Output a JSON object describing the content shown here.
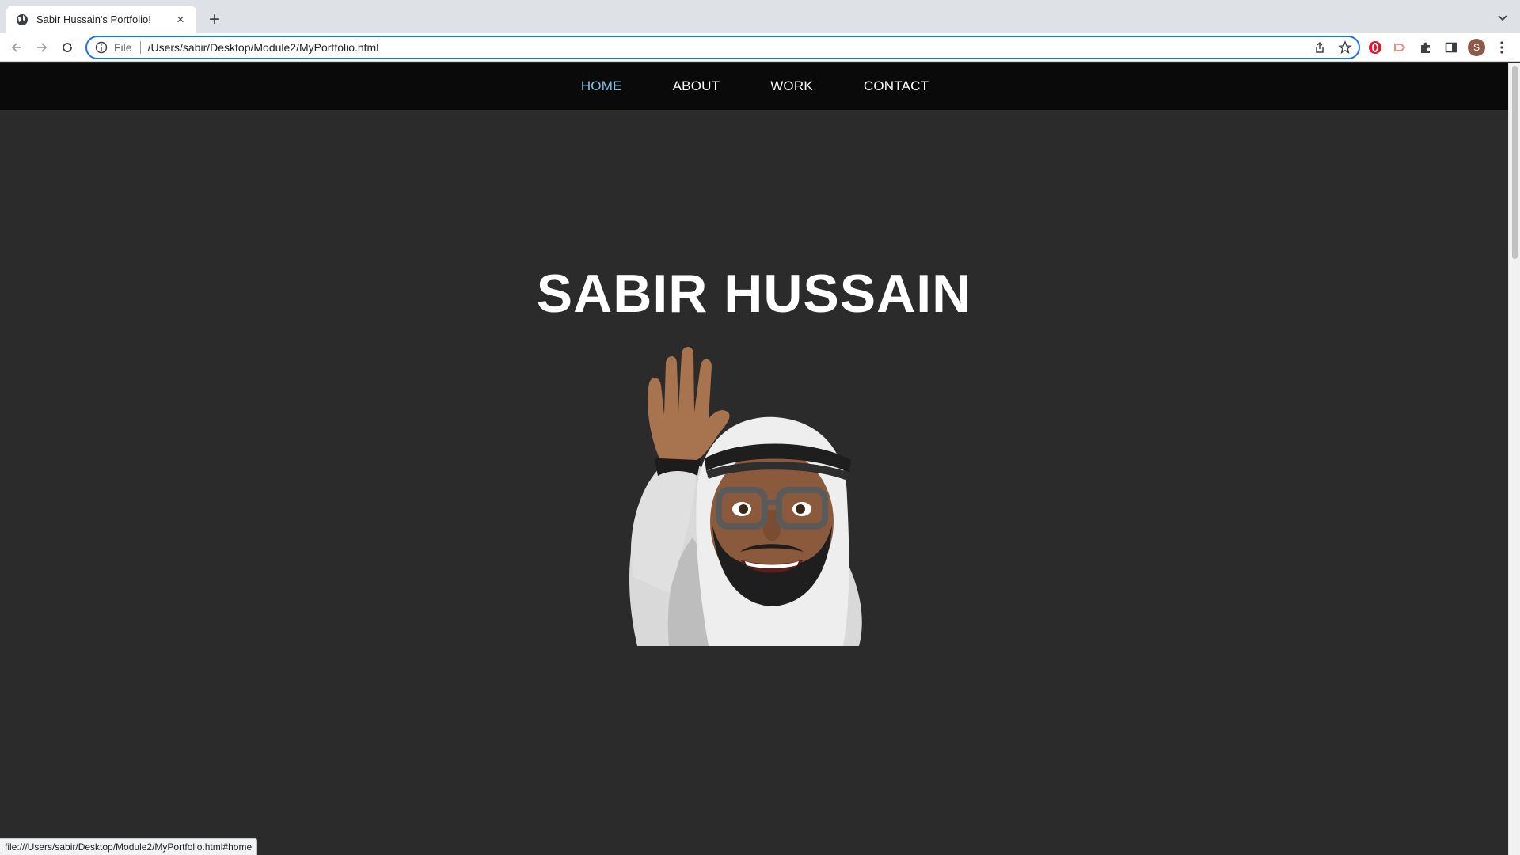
{
  "browser": {
    "tab": {
      "title": "Sabir Hussain's Portfolio!",
      "favicon": "globe-icon"
    },
    "address": {
      "scheme": "File",
      "url": "/Users/sabir/Desktop/Module2/MyPortfolio.html"
    },
    "profile_initial": "S",
    "status_url": "file:///Users/sabir/Desktop/Module2/MyPortfolio.html#home",
    "accent_color": "#1a73e8"
  },
  "site": {
    "nav": [
      {
        "label": "HOME",
        "active": true
      },
      {
        "label": "ABOUT",
        "active": false
      },
      {
        "label": "WORK",
        "active": false
      },
      {
        "label": "CONTACT",
        "active": false
      }
    ],
    "hero": {
      "title": "SABIR HUSSAIN",
      "image": "waving-memoji-avatar"
    },
    "colors": {
      "background": "#2b2b2b",
      "navbar": "#0a0a0a",
      "active_link": "#7fc3e6",
      "text": "#ffffff"
    }
  }
}
